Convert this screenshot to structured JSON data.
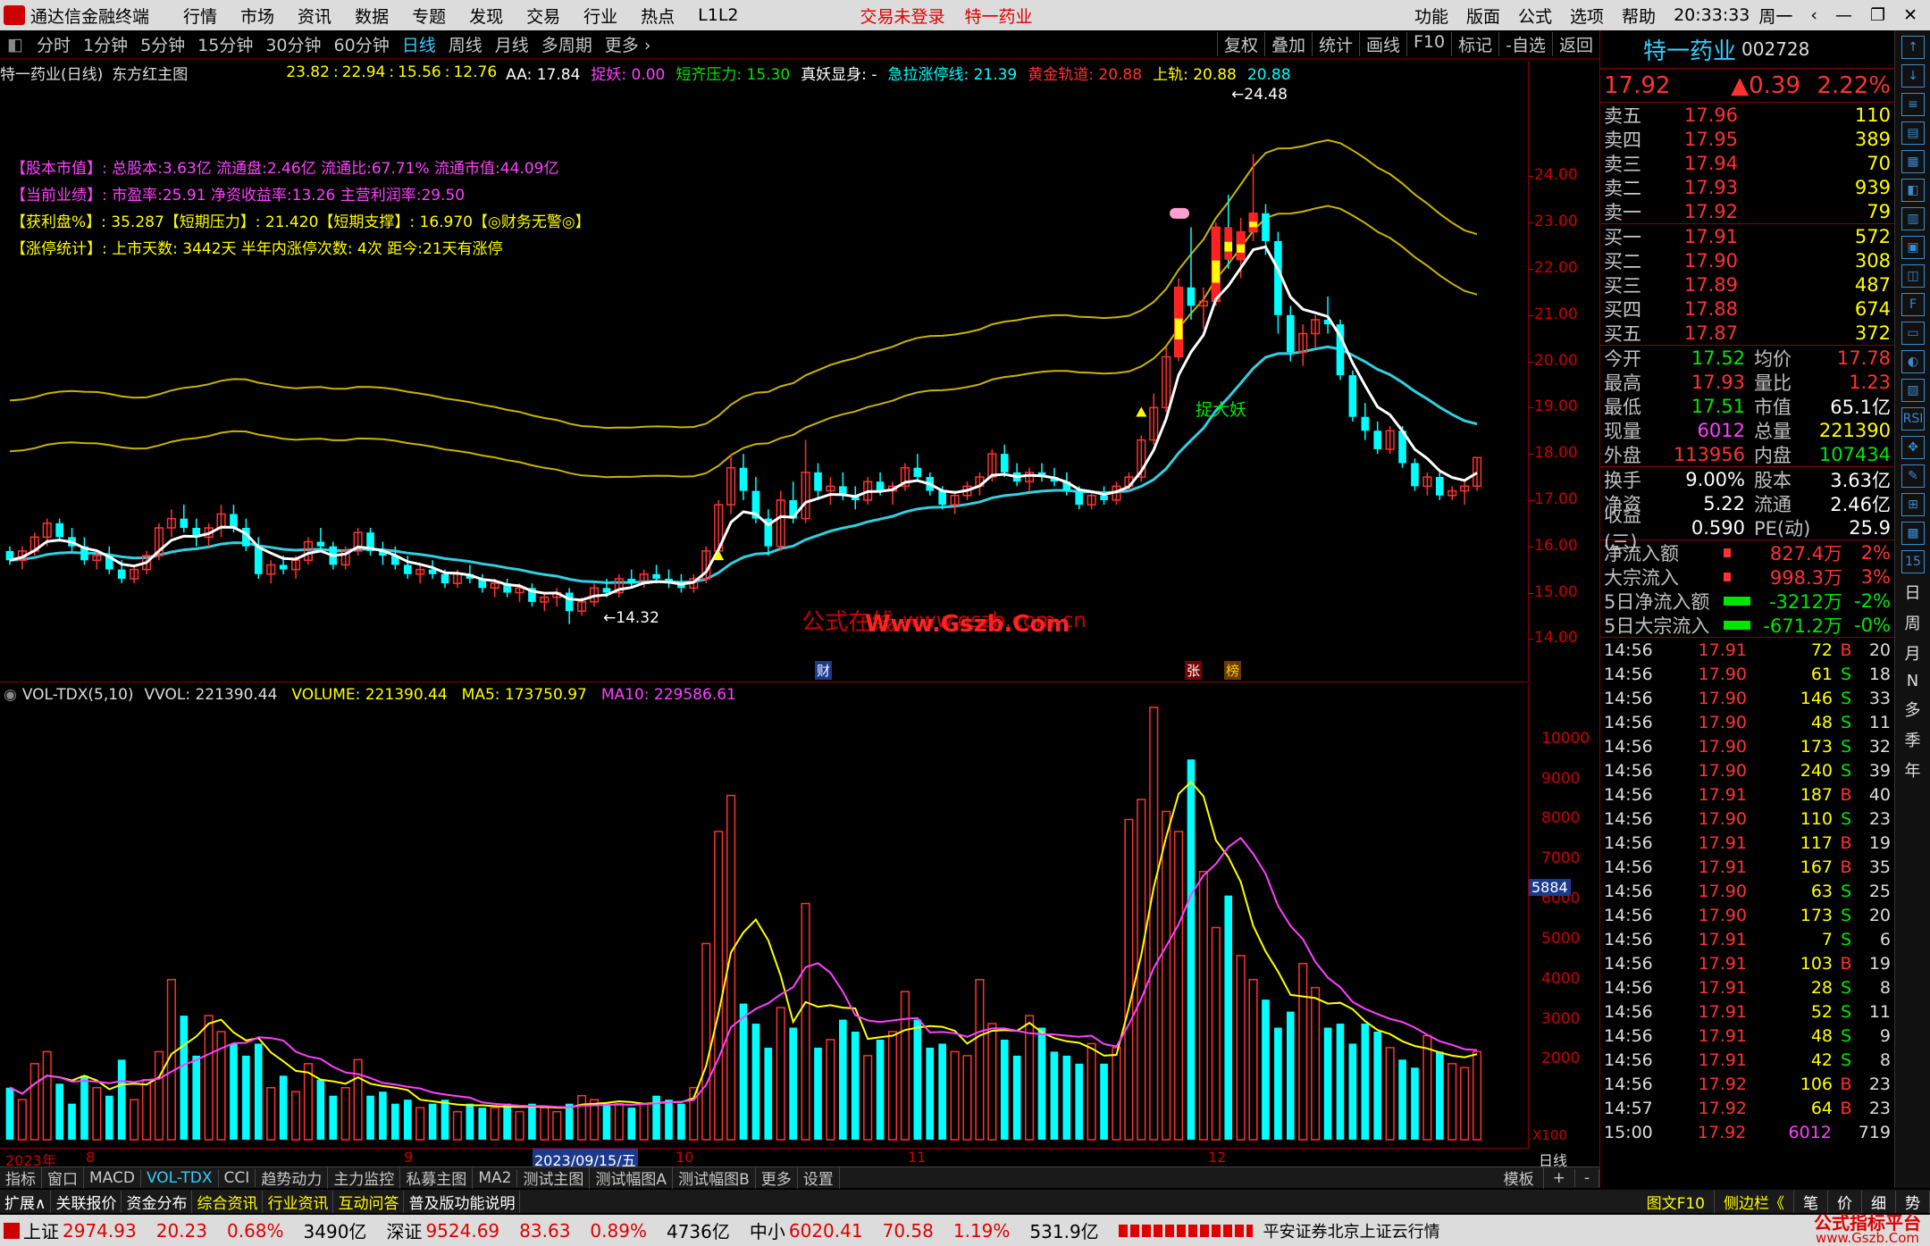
{
  "app": {
    "title": "通达信金融终端",
    "login_status": "交易未登录",
    "stock_short": "特一药业",
    "time": "20:33:33",
    "weekday": "周一"
  },
  "menu": [
    "行情",
    "市场",
    "资讯",
    "数据",
    "专题",
    "发现",
    "交易",
    "行业",
    "热点",
    "L1L2"
  ],
  "menu_right": [
    "功能",
    "版面",
    "公式",
    "选项",
    "帮助"
  ],
  "periods": [
    "分时",
    "1分钟",
    "5分钟",
    "15分钟",
    "30分钟",
    "60分钟",
    "日线",
    "周线",
    "月线",
    "多周期",
    "更多 ›"
  ],
  "period_active": 6,
  "tools": [
    "复权",
    "叠加",
    "统计",
    "画线",
    "F10",
    "标记",
    "-自选",
    "返回"
  ],
  "chart_title": "特一药业(日线)",
  "main_formula": "东方红主图",
  "info_values": [
    "23.82",
    "22.94",
    "15.56",
    "12.76"
  ],
  "indicators": [
    {
      "label": "AA: 17.84",
      "color": "#ffffff"
    },
    {
      "label": "捉妖: 0.00",
      "color": "#ff40ff"
    },
    {
      "label": "短齐压力: 15.30",
      "color": "#00e600"
    },
    {
      "label": "真妖显身: -",
      "color": "#ffffff"
    },
    {
      "label": "急拉涨停线: 21.39",
      "color": "#00ffff"
    },
    {
      "label": "黄金轨道: 20.88",
      "color": "#ff3232"
    },
    {
      "label": "上轨: 20.88",
      "color": "#ffff00"
    },
    {
      "label": "20.88",
      "color": "#00ffff"
    }
  ],
  "notes": [
    {
      "label": "【股本市值】: 总股本:3.63亿 流通盘:2.46亿 流通比:67.71% 流通市值:44.09亿",
      "color": "#ff40ff"
    },
    {
      "label": "【当前业绩】: 市盈率:25.91 净资收益率:13.26 主营利润率:29.50",
      "color": "#ff40ff"
    },
    {
      "label": "【获利盘%】: 35.287【短期压力】: 21.420【短期支撑】: 16.970【◎财务无警◎】",
      "color": "#ffff00"
    },
    {
      "label": "【涨停统计】: 上市天数: 3442天 半年内涨停次数: 4次   距今:21天有涨停",
      "color": "#ffff00"
    }
  ],
  "annotations": {
    "high": "24.48",
    "low": "14.32",
    "signal": "捉大妖",
    "watermark_cn": "公式在线",
    "watermark_url": "Www.Gszb.Com",
    "watermark_url2": "www.gszb.com.cn",
    "badge_cai": "财",
    "badge_zhang": "张",
    "badge_bang": "榜"
  },
  "vol_header": {
    "name": "VOL-TDX(5,10)",
    "vvol": "VVOL: 221390.44",
    "volume": "VOLUME: 221390.44",
    "ma5": "MA5: 173750.97",
    "ma10": "MA10: 229586.61",
    "colors": {
      "volume": "#ffff00",
      "ma10": "#ff40ff"
    }
  },
  "vol_cursor": "5884",
  "vol_unit": "X100",
  "date_axis": {
    "year": "2023年",
    "m8": "8",
    "m9": "9",
    "sel": "2023/09/15/五",
    "m10": "10",
    "m11": "11",
    "m12": "12",
    "period": "日线"
  },
  "tabs1": [
    "指标",
    "窗口",
    "MACD",
    "VOL-TDX",
    "CCI",
    "趋势动力",
    "主力监控",
    "私募主图",
    "MA2",
    "测试主图",
    "测试幅图A",
    "测试幅图B",
    "更多",
    "设置"
  ],
  "tabs1_active": 3,
  "tabs1_right": [
    "模板",
    "+",
    "-"
  ],
  "tabs2": [
    "扩展∧",
    "关联报价",
    "资金分布",
    "综合资讯",
    "行业资讯",
    "互动问答",
    "普及版功能说明"
  ],
  "tabs2_right": [
    "图文F10",
    "侧边栏《",
    "笔",
    "价",
    "细",
    "势"
  ],
  "status": {
    "sh_label": "上证",
    "sh_val": "2974.93",
    "sh_chg": "20.23",
    "sh_pct": "0.68%",
    "sh_amt": "3490亿",
    "sz_label": "深证",
    "sz_val": "9524.69",
    "sz_chg": "83.63",
    "sz_pct": "0.89%",
    "sz_amt": "4736亿",
    "zx_label": "中小",
    "zx_val": "6020.41",
    "zx_chg": "70.58",
    "zx_pct": "1.19%",
    "zx_amt": "531.9亿",
    "broker": "平安证券北京上证云行情",
    "brand": "公式指标平台",
    "brand_url": "www.Gszb.Com"
  },
  "quote": {
    "name": "特一药业",
    "code": "002728",
    "price": "17.92",
    "change": "▲0.39",
    "pct": "2.22%",
    "asks": [
      [
        "卖五",
        "17.96",
        "110"
      ],
      [
        "卖四",
        "17.95",
        "389"
      ],
      [
        "卖三",
        "17.94",
        "70"
      ],
      [
        "卖二",
        "17.93",
        "939"
      ],
      [
        "卖一",
        "17.92",
        "79"
      ]
    ],
    "bids": [
      [
        "买一",
        "17.91",
        "572"
      ],
      [
        "买二",
        "17.90",
        "308"
      ],
      [
        "买三",
        "17.89",
        "487"
      ],
      [
        "买四",
        "17.88",
        "674"
      ],
      [
        "买五",
        "17.87",
        "372"
      ]
    ],
    "stats": [
      [
        "今开",
        "17.52",
        "均价",
        "17.78"
      ],
      [
        "最高",
        "17.93",
        "量比",
        "1.23"
      ],
      [
        "最低",
        "17.51",
        "市值",
        "65.1亿"
      ],
      [
        "现量",
        "6012",
        "总量",
        "221390"
      ],
      [
        "外盘",
        "113956",
        "内盘",
        "107434"
      ]
    ],
    "stats2": [
      [
        "换手",
        "9.00%",
        "股本",
        "3.63亿"
      ],
      [
        "净资",
        "5.22",
        "流通",
        "2.46亿"
      ],
      [
        "收益(三)",
        "0.590",
        "PE(动)",
        "25.9"
      ]
    ],
    "flows": [
      [
        "净流入额",
        "827.4万",
        "2%"
      ],
      [
        "大宗流入",
        "998.3万",
        "3%"
      ],
      [
        "5日净流入额",
        "-3212万",
        "-2%"
      ],
      [
        "5日大宗流入",
        "-671.2万",
        "-0%"
      ]
    ],
    "ticks": [
      [
        "14:56",
        "17.91",
        "72",
        "B",
        "20"
      ],
      [
        "14:56",
        "17.90",
        "61",
        "S",
        "18"
      ],
      [
        "14:56",
        "17.90",
        "146",
        "S",
        "33"
      ],
      [
        "14:56",
        "17.90",
        "48",
        "S",
        "11"
      ],
      [
        "14:56",
        "17.90",
        "173",
        "S",
        "32"
      ],
      [
        "14:56",
        "17.90",
        "240",
        "S",
        "39"
      ],
      [
        "14:56",
        "17.91",
        "187",
        "B",
        "40"
      ],
      [
        "14:56",
        "17.90",
        "110",
        "S",
        "23"
      ],
      [
        "14:56",
        "17.91",
        "117",
        "B",
        "19"
      ],
      [
        "14:56",
        "17.91",
        "167",
        "B",
        "35"
      ],
      [
        "14:56",
        "17.90",
        "63",
        "S",
        "25"
      ],
      [
        "14:56",
        "17.90",
        "173",
        "S",
        "20"
      ],
      [
        "14:56",
        "17.91",
        "7",
        "S",
        "6"
      ],
      [
        "14:56",
        "17.91",
        "103",
        "B",
        "19"
      ],
      [
        "14:56",
        "17.91",
        "28",
        "S",
        "8"
      ],
      [
        "14:56",
        "17.91",
        "52",
        "S",
        "11"
      ],
      [
        "14:56",
        "17.91",
        "48",
        "S",
        "9"
      ],
      [
        "14:56",
        "17.91",
        "42",
        "S",
        "8"
      ],
      [
        "14:56",
        "17.92",
        "106",
        "B",
        "23"
      ],
      [
        "14:57",
        "17.92",
        "64",
        "B",
        "23"
      ],
      [
        "15:00",
        "17.92",
        "6012",
        "",
        "719"
      ]
    ]
  },
  "side_icons": [
    "↑",
    "↓",
    "≡",
    "▤",
    "▦",
    "◧",
    "▥",
    "▣",
    "◫",
    "F",
    "▭",
    "◐",
    "▨",
    "RSI",
    "✥",
    "✎",
    "⊞",
    "▩",
    "15"
  ],
  "side_text": [
    "日",
    "周",
    "月",
    "N",
    "多",
    "季",
    "年"
  ],
  "chart_data": {
    "type": "candlestick",
    "price_ticks": [
      24,
      23,
      22,
      21,
      20,
      19,
      18,
      17,
      16,
      15,
      14
    ],
    "price_range": [
      13.6,
      24.8
    ],
    "vol_ticks": [
      10000,
      9000,
      8000,
      7000,
      6000,
      5000,
      4000,
      3000,
      2000
    ],
    "vol_range": [
      0,
      10800
    ],
    "high": 24.48,
    "low": 14.32,
    "ohlc": [
      [
        15.9,
        16.0,
        15.6,
        15.7
      ],
      [
        15.7,
        16.0,
        15.5,
        15.9
      ],
      [
        15.9,
        16.3,
        15.8,
        16.2
      ],
      [
        16.2,
        16.6,
        16.0,
        16.5
      ],
      [
        16.5,
        16.6,
        16.1,
        16.2
      ],
      [
        16.2,
        16.4,
        15.9,
        16.0
      ],
      [
        16.0,
        16.2,
        15.6,
        15.7
      ],
      [
        15.7,
        15.9,
        15.5,
        15.8
      ],
      [
        15.8,
        16.0,
        15.4,
        15.5
      ],
      [
        15.5,
        15.7,
        15.2,
        15.3
      ],
      [
        15.3,
        15.6,
        15.2,
        15.5
      ],
      [
        15.5,
        15.9,
        15.4,
        15.8
      ],
      [
        15.8,
        16.5,
        15.7,
        16.4
      ],
      [
        16.4,
        16.8,
        16.2,
        16.6
      ],
      [
        16.6,
        16.9,
        16.3,
        16.4
      ],
      [
        16.4,
        16.6,
        16.0,
        16.2
      ],
      [
        16.2,
        16.5,
        16.0,
        16.4
      ],
      [
        16.4,
        16.9,
        16.2,
        16.7
      ],
      [
        16.7,
        16.9,
        16.3,
        16.4
      ],
      [
        16.4,
        16.6,
        15.9,
        16.0
      ],
      [
        16.0,
        16.2,
        15.3,
        15.4
      ],
      [
        15.4,
        15.7,
        15.2,
        15.6
      ],
      [
        15.6,
        15.8,
        15.4,
        15.5
      ],
      [
        15.5,
        15.8,
        15.3,
        15.7
      ],
      [
        15.7,
        16.2,
        15.6,
        16.1
      ],
      [
        16.1,
        16.4,
        15.9,
        16.0
      ],
      [
        16.0,
        16.1,
        15.5,
        15.6
      ],
      [
        15.6,
        16.0,
        15.5,
        15.9
      ],
      [
        15.9,
        16.4,
        15.8,
        16.3
      ],
      [
        16.3,
        16.4,
        15.8,
        15.9
      ],
      [
        15.9,
        16.1,
        15.6,
        15.8
      ],
      [
        15.8,
        16.0,
        15.5,
        15.6
      ],
      [
        15.6,
        15.8,
        15.3,
        15.4
      ],
      [
        15.4,
        15.6,
        15.2,
        15.5
      ],
      [
        15.5,
        15.7,
        15.3,
        15.4
      ],
      [
        15.4,
        15.5,
        15.1,
        15.2
      ],
      [
        15.2,
        15.5,
        15.1,
        15.4
      ],
      [
        15.4,
        15.6,
        15.2,
        15.3
      ],
      [
        15.3,
        15.4,
        15.0,
        15.1
      ],
      [
        15.1,
        15.3,
        14.9,
        15.2
      ],
      [
        15.2,
        15.3,
        14.9,
        15.0
      ],
      [
        15.0,
        15.2,
        14.8,
        15.1
      ],
      [
        15.1,
        15.2,
        14.7,
        14.8
      ],
      [
        14.8,
        15.0,
        14.6,
        14.9
      ],
      [
        14.9,
        15.1,
        14.7,
        15.0
      ],
      [
        15.0,
        15.1,
        14.32,
        14.6
      ],
      [
        14.6,
        14.9,
        14.5,
        14.8
      ],
      [
        14.8,
        15.2,
        14.7,
        15.1
      ],
      [
        15.1,
        15.3,
        14.9,
        15.0
      ],
      [
        15.0,
        15.4,
        14.9,
        15.3
      ],
      [
        15.3,
        15.5,
        15.1,
        15.2
      ],
      [
        15.2,
        15.5,
        15.1,
        15.4
      ],
      [
        15.4,
        15.6,
        15.2,
        15.3
      ],
      [
        15.3,
        15.5,
        15.1,
        15.2
      ],
      [
        15.2,
        15.4,
        15.0,
        15.1
      ],
      [
        15.1,
        15.4,
        15.0,
        15.3
      ],
      [
        15.3,
        16.0,
        15.2,
        15.9
      ],
      [
        15.9,
        17.0,
        15.8,
        16.9
      ],
      [
        16.9,
        18.0,
        16.7,
        17.7
      ],
      [
        17.7,
        18.0,
        17.0,
        17.2
      ],
      [
        17.2,
        17.5,
        16.5,
        16.6
      ],
      [
        16.6,
        16.8,
        15.8,
        16.0
      ],
      [
        16.0,
        17.2,
        15.9,
        17.0
      ],
      [
        17.0,
        17.4,
        16.5,
        16.6
      ],
      [
        16.6,
        18.3,
        16.5,
        17.6
      ],
      [
        17.6,
        17.8,
        17.0,
        17.2
      ],
      [
        17.2,
        17.5,
        16.9,
        17.3
      ],
      [
        17.3,
        17.6,
        17.0,
        17.1
      ],
      [
        17.1,
        17.3,
        16.8,
        17.0
      ],
      [
        17.0,
        17.5,
        16.9,
        17.4
      ],
      [
        17.4,
        17.6,
        17.1,
        17.2
      ],
      [
        17.2,
        17.4,
        16.9,
        17.3
      ],
      [
        17.3,
        17.8,
        17.2,
        17.7
      ],
      [
        17.7,
        18.0,
        17.4,
        17.5
      ],
      [
        17.5,
        17.6,
        17.1,
        17.2
      ],
      [
        17.2,
        17.3,
        16.8,
        16.9
      ],
      [
        16.9,
        17.2,
        16.7,
        17.1
      ],
      [
        17.1,
        17.4,
        17.0,
        17.3
      ],
      [
        17.3,
        17.6,
        17.1,
        17.5
      ],
      [
        17.5,
        18.1,
        17.4,
        18.0
      ],
      [
        18.0,
        18.2,
        17.5,
        17.6
      ],
      [
        17.6,
        17.8,
        17.3,
        17.4
      ],
      [
        17.4,
        17.7,
        17.2,
        17.6
      ],
      [
        17.6,
        17.8,
        17.4,
        17.5
      ],
      [
        17.5,
        17.7,
        17.3,
        17.4
      ],
      [
        17.4,
        17.6,
        17.1,
        17.2
      ],
      [
        17.2,
        17.3,
        16.8,
        16.9
      ],
      [
        16.9,
        17.2,
        16.8,
        17.1
      ],
      [
        17.1,
        17.3,
        16.9,
        17.0
      ],
      [
        17.0,
        17.4,
        16.9,
        17.3
      ],
      [
        17.3,
        17.6,
        17.2,
        17.5
      ],
      [
        17.5,
        18.4,
        17.4,
        18.3
      ],
      [
        18.3,
        19.3,
        18.2,
        19.0
      ],
      [
        19.0,
        20.3,
        18.9,
        20.1
      ],
      [
        20.1,
        21.8,
        20.0,
        21.6
      ],
      [
        21.6,
        22.9,
        20.9,
        21.2
      ],
      [
        21.2,
        21.6,
        20.7,
        21.3
      ],
      [
        21.3,
        23.0,
        21.2,
        22.9
      ],
      [
        22.9,
        23.6,
        22.0,
        22.2
      ],
      [
        22.2,
        23.1,
        21.8,
        22.8
      ],
      [
        22.8,
        24.48,
        22.6,
        23.2
      ],
      [
        23.2,
        23.4,
        22.3,
        22.6
      ],
      [
        22.6,
        22.8,
        20.6,
        21.0
      ],
      [
        21.0,
        21.2,
        20.0,
        20.2
      ],
      [
        20.2,
        20.8,
        19.9,
        20.6
      ],
      [
        20.6,
        21.0,
        20.3,
        20.9
      ],
      [
        20.9,
        21.4,
        20.6,
        20.8
      ],
      [
        20.8,
        20.9,
        19.6,
        19.7
      ],
      [
        19.7,
        19.8,
        18.7,
        18.8
      ],
      [
        18.8,
        19.1,
        18.3,
        18.5
      ],
      [
        18.5,
        18.7,
        18.0,
        18.1
      ],
      [
        18.1,
        18.6,
        18.0,
        18.5
      ],
      [
        18.5,
        18.6,
        17.7,
        17.8
      ],
      [
        17.8,
        17.9,
        17.2,
        17.3
      ],
      [
        17.3,
        17.6,
        17.1,
        17.5
      ],
      [
        17.5,
        17.6,
        17.0,
        17.1
      ],
      [
        17.1,
        17.3,
        17.0,
        17.2
      ],
      [
        17.2,
        17.4,
        16.9,
        17.3
      ],
      [
        17.3,
        17.93,
        17.2,
        17.92
      ]
    ],
    "volume": [
      1300,
      1000,
      1900,
      2200,
      1400,
      900,
      1600,
      1300,
      1100,
      2000,
      1000,
      1500,
      2200,
      4000,
      3100,
      2100,
      3100,
      2700,
      2400,
      2100,
      2400,
      1300,
      1600,
      1200,
      1900,
      1500,
      1100,
      1300,
      2000,
      1100,
      1200,
      900,
      1000,
      800,
      900,
      1000,
      700,
      900,
      800,
      800,
      900,
      700,
      900,
      800,
      700,
      900,
      1100,
      1000,
      900,
      900,
      800,
      900,
      1100,
      1000,
      900,
      1300,
      4900,
      7700,
      8600,
      3400,
      2900,
      2300,
      3300,
      2800,
      5900,
      2300,
      2500,
      3000,
      2700,
      2100,
      2500,
      2700,
      3700,
      3000,
      2300,
      2400,
      2200,
      2100,
      4000,
      2900,
      2500,
      2100,
      3100,
      2800,
      2200,
      2100,
      1900,
      2400,
      1900,
      2300,
      8000,
      8500,
      10800,
      8200,
      7700,
      9500,
      6700,
      5300,
      6100,
      4600,
      4000,
      3500,
      2800,
      3200,
      4400,
      3800,
      2800,
      2900,
      2400,
      2900,
      2700,
      2300,
      2000,
      1800,
      2600,
      2200,
      1900,
      1800,
      2200
    ]
  }
}
